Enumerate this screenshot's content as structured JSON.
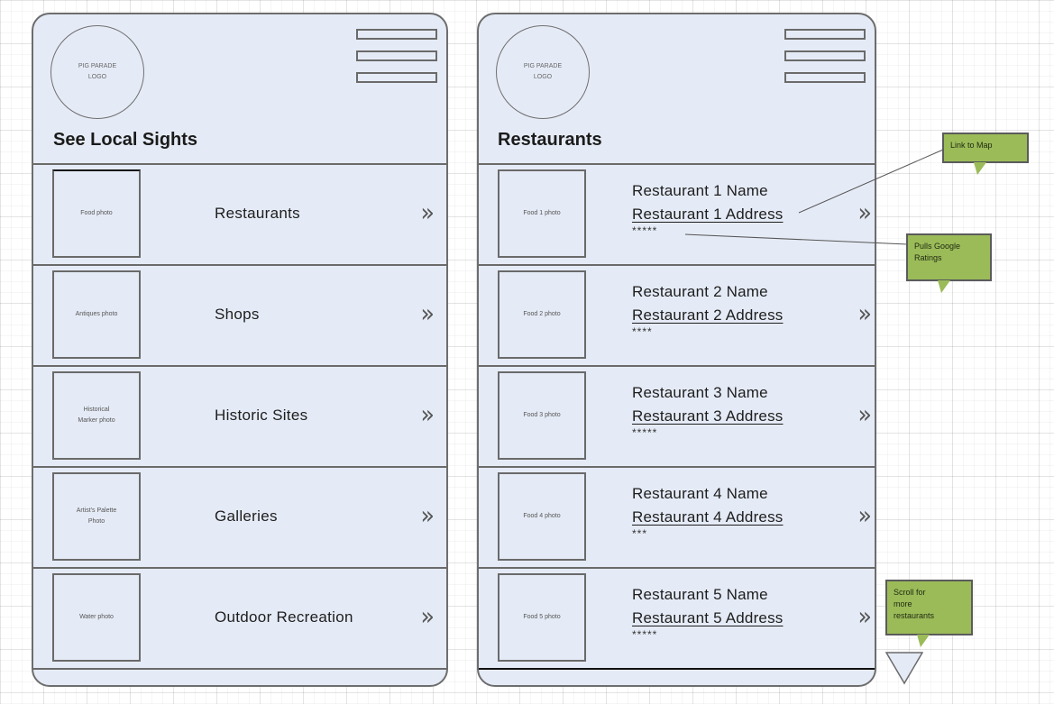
{
  "screens": {
    "left": {
      "logo_text": "PIG PARADE\nLOGO",
      "title": "See Local Sights",
      "menu_icon": "hamburger-menu-icon",
      "categories": [
        {
          "photo": "Food photo",
          "label": "Restaurants"
        },
        {
          "photo": "Antiques photo",
          "label": "Shops"
        },
        {
          "photo": "Historical\nMarker photo",
          "label": "Historic Sites"
        },
        {
          "photo": "Artist's Palette\nPhoto",
          "label": "Galleries"
        },
        {
          "photo": "Water photo",
          "label": "Outdoor Recreation"
        }
      ],
      "chevron": "»"
    },
    "right": {
      "logo_text": "PIG PARADE\nLOGO",
      "title": "Restaurants",
      "menu_icon": "hamburger-menu-icon",
      "restaurants": [
        {
          "photo": "Food 1 photo",
          "name": "Restaurant 1 Name",
          "address": "Restaurant 1 Address",
          "rating": 5,
          "stars": "*****"
        },
        {
          "photo": "Food 2 photo",
          "name": "Restaurant 2 Name",
          "address": "Restaurant 2 Address",
          "rating": 4,
          "stars": "****"
        },
        {
          "photo": "Food 3 photo",
          "name": "Restaurant 3 Name",
          "address": "Restaurant 3 Address",
          "rating": 5,
          "stars": "*****"
        },
        {
          "photo": "Food 4 photo",
          "name": "Restaurant 4 Name",
          "address": "Restaurant 4 Address",
          "rating": 3,
          "stars": "***"
        },
        {
          "photo": "Food 5 photo",
          "name": "Restaurant 5 Name",
          "address": "Restaurant 5 Address",
          "rating": 5,
          "stars": "*****"
        }
      ],
      "chevron": "»"
    }
  },
  "callouts": {
    "map": "Link to Map",
    "ratings": "Pulls Google\nRatings",
    "scroll": "Scroll for\nmore\nrestaurants"
  },
  "colors": {
    "screen_bg": "#e5ebf6",
    "callout_bg": "#9bbb59",
    "border": "#6a6a6a"
  }
}
